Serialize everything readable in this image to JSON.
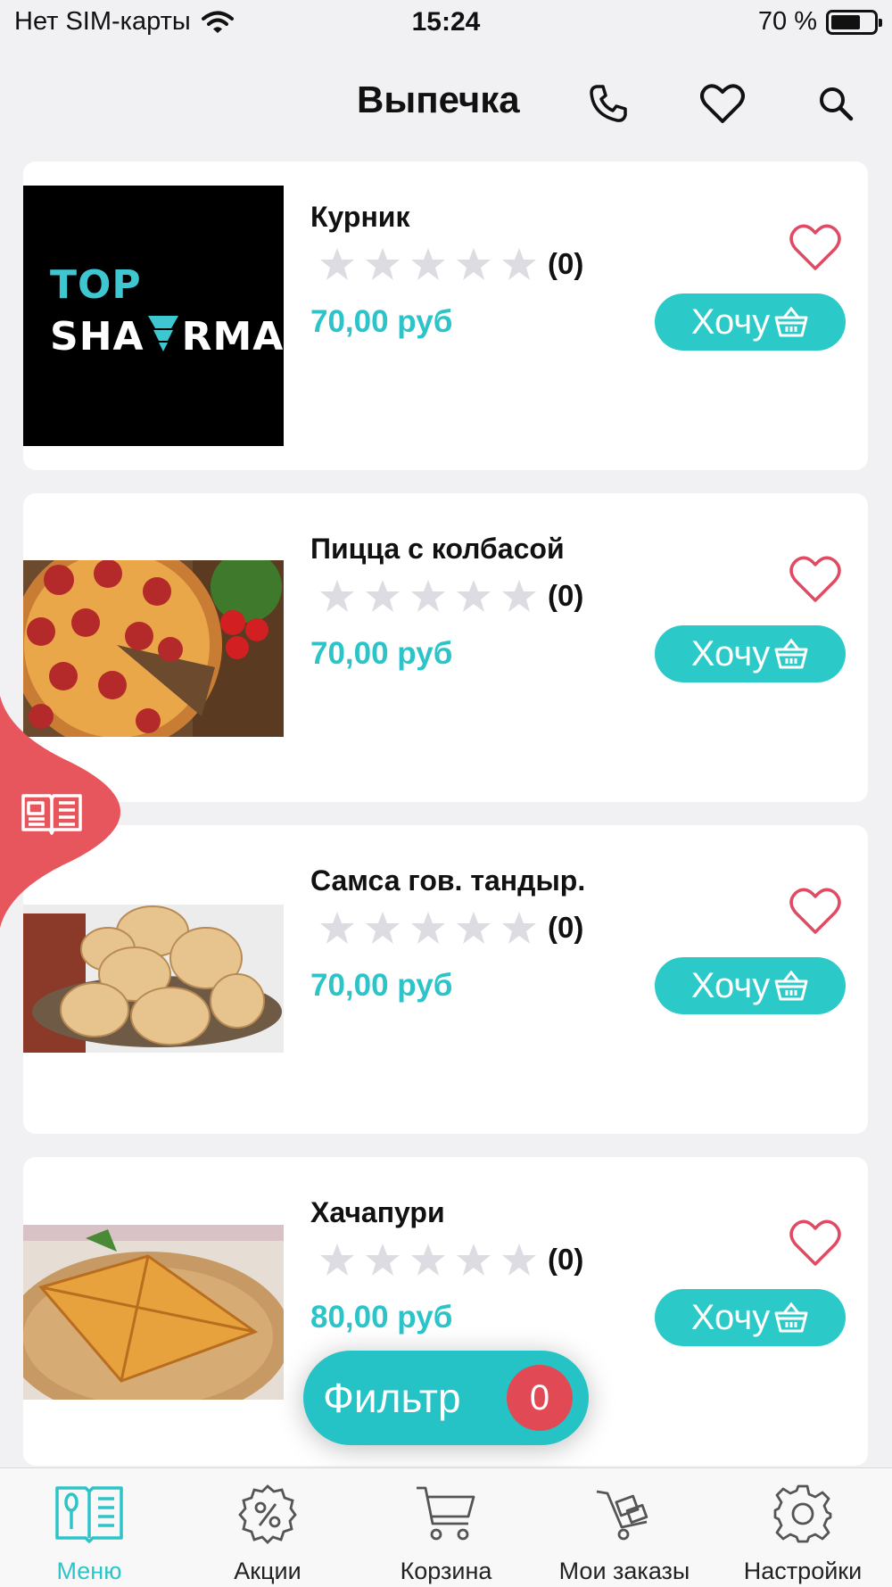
{
  "status_bar": {
    "carrier": "Нет SIM-карты",
    "time": "15:24",
    "battery": "70 %",
    "battery_level": 0.7
  },
  "header": {
    "title": "Выпечка",
    "icons": [
      "phone-icon",
      "heart-icon",
      "search-icon"
    ]
  },
  "products": [
    {
      "name": "Курник",
      "rating_count": "(0)",
      "price": "70,00 руб",
      "button": "Хочу",
      "image": "top-shawarma-logo",
      "logo_line1": "TOP",
      "logo_line2a": "SHA",
      "logo_line2b": "RMA"
    },
    {
      "name": "Пицца с колбасой",
      "rating_count": "(0)",
      "price": "70,00 руб",
      "button": "Хочу",
      "image": "pepperoni-pizza"
    },
    {
      "name": "Самса гов. тандыр.",
      "rating_count": "(0)",
      "price": "70,00 руб",
      "button": "Хочу",
      "image": "samsa-buns"
    },
    {
      "name": "Хачапури",
      "rating_count": "(0)",
      "price": "80,00 руб",
      "button": "Хочу",
      "image": "khachapuri"
    }
  ],
  "filter": {
    "label": "Фильтр",
    "count": "0"
  },
  "tabbar": {
    "items": [
      {
        "label": "Меню",
        "icon": "menu-book-icon",
        "active": true
      },
      {
        "label": "Акции",
        "icon": "discount-icon",
        "active": false
      },
      {
        "label": "Корзина",
        "icon": "cart-icon",
        "active": false
      },
      {
        "label": "Мои заказы",
        "icon": "orders-icon",
        "active": false
      },
      {
        "label": "Настройки",
        "icon": "settings-icon",
        "active": false
      }
    ]
  },
  "colors": {
    "accent": "#2cc4c9",
    "badge": "#e14a55",
    "heart": "#e04a63",
    "star": "#dcdce2"
  }
}
